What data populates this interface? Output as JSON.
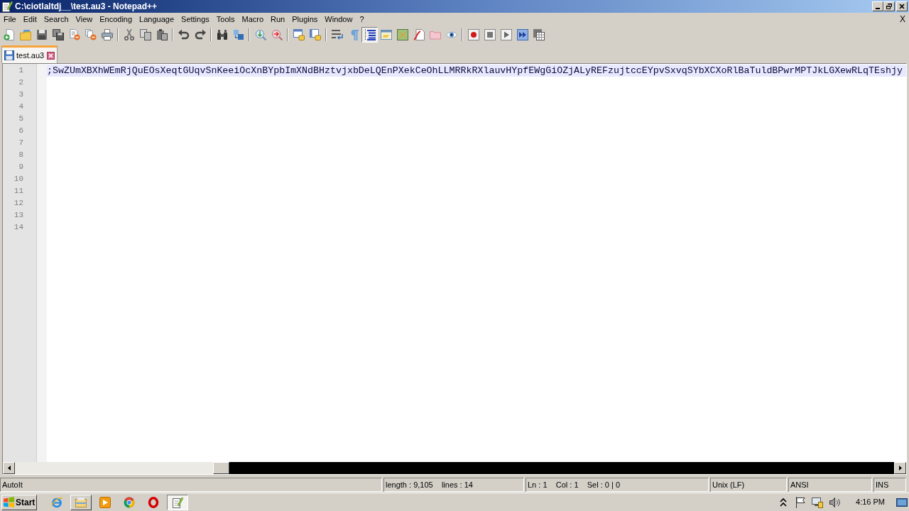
{
  "window": {
    "title": "C:\\ciotlaltdj__\\test.au3 - Notepad++"
  },
  "menu": {
    "items": [
      "File",
      "Edit",
      "Search",
      "View",
      "Encoding",
      "Language",
      "Settings",
      "Tools",
      "Macro",
      "Run",
      "Plugins",
      "Window",
      "?"
    ],
    "close_label": "X"
  },
  "toolbar": [
    [
      {
        "pressed": false
      },
      {
        "pressed": false
      },
      {
        "pressed": false
      },
      {
        "pressed": false
      },
      {
        "pressed": false
      },
      {
        "pressed": false
      },
      {
        "pressed": false
      }
    ],
    [
      {
        "pressed": false
      },
      {
        "pressed": false
      },
      {
        "pressed": false
      }
    ],
    [
      {
        "pressed": false
      },
      {
        "pressed": false
      }
    ],
    [
      {
        "pressed": false
      },
      {
        "pressed": false
      }
    ],
    [
      {
        "pressed": false
      },
      {
        "pressed": false
      }
    ],
    [
      {
        "pressed": false
      },
      {
        "pressed": false
      }
    ],
    [
      {
        "pressed": false
      },
      {
        "pressed": false
      },
      {
        "pressed": true
      },
      {
        "pressed": false
      },
      {
        "pressed": false
      },
      {
        "pressed": false
      },
      {
        "pressed": false
      },
      {
        "pressed": false
      }
    ],
    [
      {
        "pressed": false
      },
      {
        "pressed": false
      },
      {
        "pressed": false
      },
      {
        "pressed": false
      },
      {
        "pressed": false
      }
    ]
  ],
  "tabs": [
    {
      "label": "test.au3",
      "selected": true
    }
  ],
  "editor": {
    "lines": [
      {
        "number": "1",
        "text": ";SwZUmXBXhWEmRjQuEOsXeqtGUqvSnKeeiOcXnBYpbImXNdBHztvjxbDeLQEnPXekCeOhLLMRRkRXlauvHYpfEWgGiOZjALyREFzujtccEYpvSxvqSYbXCXoRlBaTuldBPwrMPTJkLGXewRLqTEshjy",
        "current": true
      },
      {
        "number": "2",
        "current": false
      },
      {
        "number": "3",
        "current": false
      },
      {
        "number": "4",
        "current": false
      },
      {
        "number": "5",
        "current": false
      },
      {
        "number": "6",
        "current": false
      },
      {
        "number": "7",
        "current": false
      },
      {
        "number": "8",
        "current": false
      },
      {
        "number": "9",
        "current": false
      },
      {
        "number": "10",
        "current": false
      },
      {
        "number": "11",
        "current": false
      },
      {
        "number": "12",
        "current": false
      },
      {
        "number": "13",
        "current": false
      },
      {
        "number": "14",
        "current": false
      }
    ]
  },
  "status_bar": [
    "AutoIt",
    "length : 9,105    lines : 14",
    "Ln : 1    Col : 1    Sel : 0 | 0",
    "Unix (LF)",
    "ANSI",
    "INS"
  ],
  "taskbar": {
    "start": "Start",
    "apps": [
      {
        "running": false,
        "active": false
      },
      {
        "running": true,
        "active": false
      },
      {
        "running": false,
        "active": false
      },
      {
        "running": false,
        "active": false
      },
      {
        "running": false,
        "active": false
      },
      {
        "running": true,
        "active": true
      }
    ],
    "clock": "4:16 PM"
  }
}
